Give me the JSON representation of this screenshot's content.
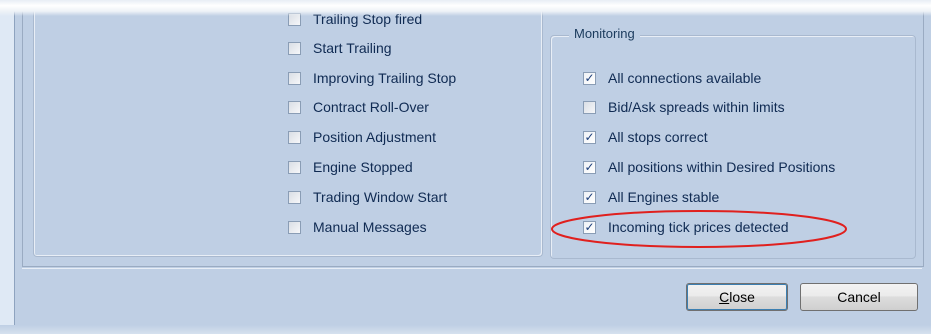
{
  "left_options": [
    {
      "label": "Trailing Stop fired",
      "checked": false
    },
    {
      "label": "Start Trailing",
      "checked": false
    },
    {
      "label": "Improving Trailing Stop",
      "checked": false
    },
    {
      "label": "Contract Roll-Over",
      "checked": false
    },
    {
      "label": "Position Adjustment",
      "checked": false
    },
    {
      "label": "Engine Stopped",
      "checked": false
    },
    {
      "label": "Trading Window Start",
      "checked": false
    },
    {
      "label": "Manual Messages",
      "checked": false
    }
  ],
  "monitoring": {
    "legend": "Monitoring",
    "items": [
      {
        "label": "All connections available",
        "checked": true
      },
      {
        "label": "Bid/Ask spreads within limits",
        "checked": false
      },
      {
        "label": "All stops correct",
        "checked": true
      },
      {
        "label": "All positions within Desired Positions",
        "checked": true
      },
      {
        "label": "All Engines stable",
        "checked": true
      },
      {
        "label": "Incoming tick prices detected",
        "checked": true
      }
    ]
  },
  "buttons": {
    "close_mnemonic": "C",
    "close_rest": "lose",
    "cancel": "Cancel"
  },
  "colors": {
    "highlight": "#e0201e",
    "panel": "#bfcfe4",
    "text": "#0f2a52"
  }
}
